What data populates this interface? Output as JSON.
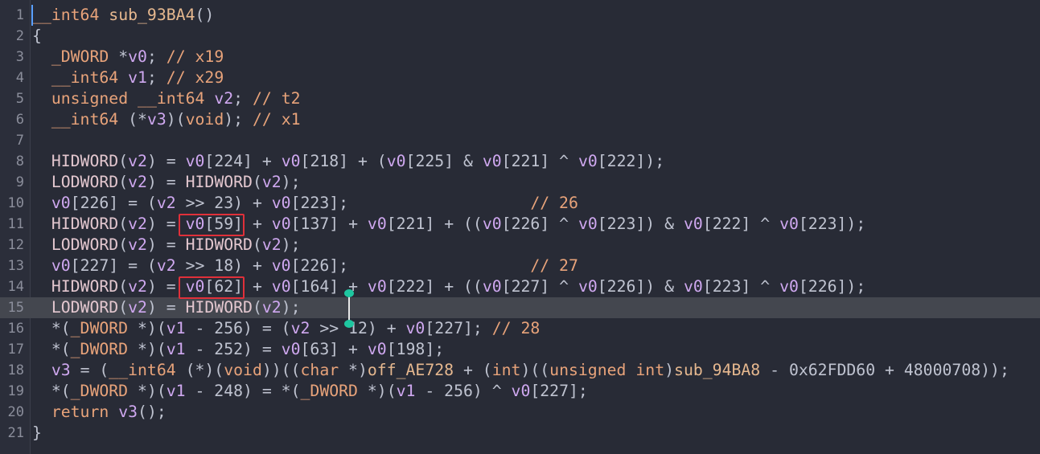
{
  "editor": {
    "current_line": 15,
    "colors": {
      "background": "#282b36",
      "gutter": "#2b2e3a",
      "current_line": "#44474f",
      "keyword": "#e8a37a",
      "variable": "#cfa8f0",
      "highlight_box": "#e0303a",
      "marker": "#1ec6a0"
    },
    "lines": [
      {
        "n": "1",
        "text": "__int64 sub_93BA4()"
      },
      {
        "n": "2",
        "text": "{"
      },
      {
        "n": "3",
        "text": "  _DWORD *v0; // x19"
      },
      {
        "n": "4",
        "text": "  __int64 v1; // x29"
      },
      {
        "n": "5",
        "text": "  unsigned __int64 v2; // t2"
      },
      {
        "n": "6",
        "text": "  __int64 (*v3)(void); // x1"
      },
      {
        "n": "7",
        "text": ""
      },
      {
        "n": "8",
        "text": "  HIDWORD(v2) = v0[224] + v0[218] + (v0[225] & v0[221] ^ v0[222]);"
      },
      {
        "n": "9",
        "text": "  LODWORD(v2) = HIDWORD(v2);"
      },
      {
        "n": "10",
        "text": "  v0[226] = (v2 >> 23) + v0[223];                   // 26"
      },
      {
        "n": "11",
        "text": "  HIDWORD(v2) = v0[59] + v0[137] + v0[221] + ((v0[226] ^ v0[223]) & v0[222] ^ v0[223]);"
      },
      {
        "n": "12",
        "text": "  LODWORD(v2) = HIDWORD(v2);"
      },
      {
        "n": "13",
        "text": "  v0[227] = (v2 >> 18) + v0[226];                   // 27"
      },
      {
        "n": "14",
        "text": "  HIDWORD(v2) = v0[62] + v0[164] + v0[222] + ((v0[227] ^ v0[226]) & v0[223] ^ v0[226]);"
      },
      {
        "n": "15",
        "text": "  LODWORD(v2) = HIDWORD(v2);"
      },
      {
        "n": "16",
        "text": "  *(_DWORD *)(v1 - 256) = (v2 >> 12) + v0[227]; // 28"
      },
      {
        "n": "17",
        "text": "  *(_DWORD *)(v1 - 252) = v0[63] + v0[198];"
      },
      {
        "n": "18",
        "text": "  v3 = (__int64 (*)(void))((char *)off_AE728 + (int)((unsigned int)sub_94BA8 - 0x62FDD60 + 48000708));"
      },
      {
        "n": "19",
        "text": "  *(_DWORD *)(v1 - 248) = *(_DWORD *)(v1 - 256) ^ v0[227];"
      },
      {
        "n": "20",
        "text": "  return v3();"
      },
      {
        "n": "21",
        "text": "}"
      }
    ]
  }
}
